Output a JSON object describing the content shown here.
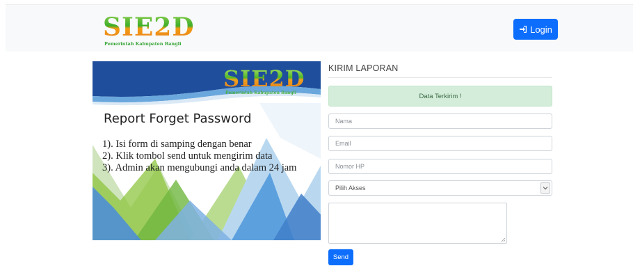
{
  "header": {
    "logo_title": "SIE2D",
    "logo_subtitle": "Pemerintah Kabupaten Bangli",
    "login_label": "Login"
  },
  "banner": {
    "logo_title": "SIE2D",
    "logo_subtitle": "Pemerintah Kabupaten Bangli",
    "title": "Report Forget Password",
    "steps": [
      "1). Isi form di samping dengan benar",
      "2). Klik tombol send untuk mengirim data",
      "3). Admin akan mengubungi anda dalam 24 jam"
    ],
    "colors": {
      "navy": "#1f4e9c",
      "sky": "#9fc6ea",
      "green": "#8dc63f"
    }
  },
  "form": {
    "title": "KIRIM LAPORAN",
    "alert_text": "Data Terkirim !",
    "nama_placeholder": "Nama",
    "email_placeholder": "Email",
    "hp_placeholder": "Nomor HP",
    "akses_selected": "Pilih Akses",
    "textarea_value": "",
    "send_label": "Send"
  },
  "colors": {
    "primary": "#0d6efd",
    "alert_bg": "#d4edda",
    "navbar_bg": "#f8f9fa"
  },
  "icons": {
    "login": "sign-in-icon",
    "select": "chevron-down-icon"
  }
}
